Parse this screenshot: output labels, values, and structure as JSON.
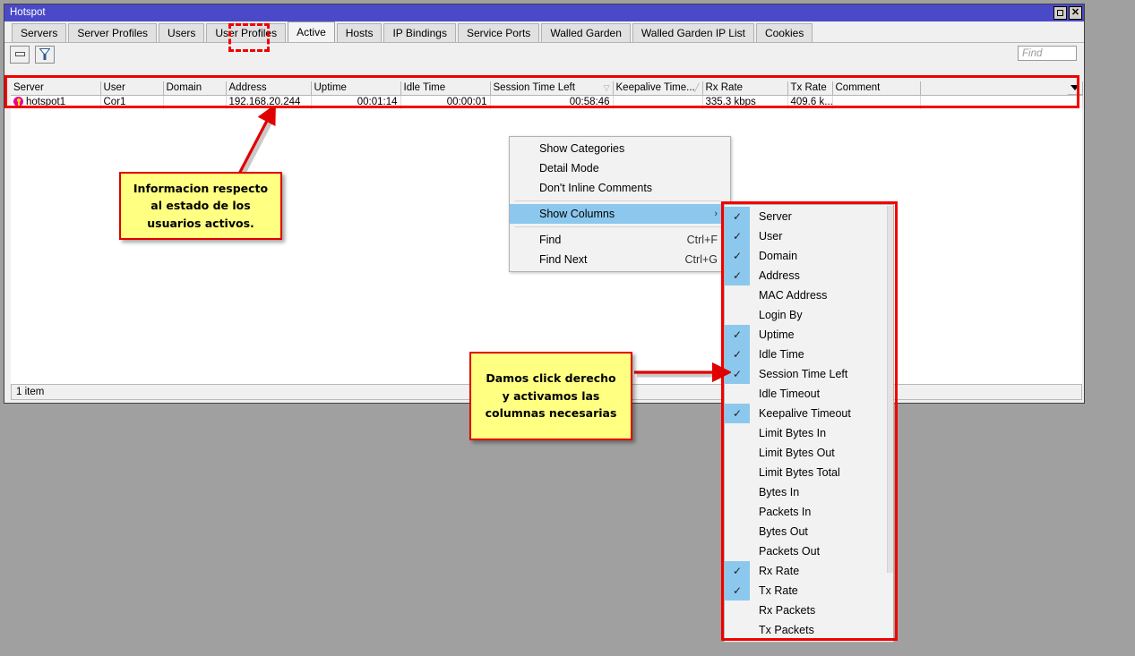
{
  "window": {
    "title": "Hotspot",
    "maximize_icon": "maximize-icon",
    "close_icon": "close-icon"
  },
  "tabs": [
    {
      "label": "Servers",
      "active": false
    },
    {
      "label": "Server Profiles",
      "active": false
    },
    {
      "label": "Users",
      "active": false
    },
    {
      "label": "User Profiles",
      "active": false
    },
    {
      "label": "Active",
      "active": true
    },
    {
      "label": "Hosts",
      "active": false
    },
    {
      "label": "IP Bindings",
      "active": false
    },
    {
      "label": "Service Ports",
      "active": false
    },
    {
      "label": "Walled Garden",
      "active": false
    },
    {
      "label": "Walled Garden IP List",
      "active": false
    },
    {
      "label": "Cookies",
      "active": false
    }
  ],
  "toolbar": {
    "remove_icon": "minus-icon",
    "filter_icon": "funnel-icon",
    "find_placeholder": "Find",
    "find_value": ""
  },
  "table": {
    "columns": [
      {
        "label": "Server",
        "sort": ""
      },
      {
        "label": "User",
        "sort": ""
      },
      {
        "label": "Domain",
        "sort": ""
      },
      {
        "label": "Address",
        "sort": ""
      },
      {
        "label": "Uptime",
        "sort": ""
      },
      {
        "label": "Idle Time",
        "sort": ""
      },
      {
        "label": "Session Time Left",
        "sort": "▽"
      },
      {
        "label": "Keepalive Time...",
        "sort": "╱"
      },
      {
        "label": "Rx Rate",
        "sort": ""
      },
      {
        "label": "Tx Rate",
        "sort": ""
      },
      {
        "label": "Comment",
        "sort": ""
      },
      {
        "label": "",
        "sort": ""
      }
    ],
    "rows": [
      {
        "icon": "hotspot-server-icon",
        "server": "hotspot1",
        "user": "Cor1",
        "domain": "",
        "address": "192.168.20.244",
        "uptime": "00:01:14",
        "idle_time": "00:00:01",
        "session_time_left": "00:58:46",
        "keepalive_timeout": "",
        "rx_rate": "335.3 kbps",
        "tx_rate": "409.6 k...",
        "comment": ""
      }
    ],
    "column_menu_icon": "chevron-down-icon"
  },
  "status": {
    "item_count": "1 item"
  },
  "context_menu": {
    "items": [
      {
        "label": "Show Categories",
        "accel": "",
        "selected": false,
        "submenu": false,
        "separator_after": false
      },
      {
        "label": "Detail Mode",
        "accel": "",
        "selected": false,
        "submenu": false,
        "separator_after": false
      },
      {
        "label": "Don't Inline Comments",
        "accel": "",
        "selected": false,
        "submenu": false,
        "separator_after": true
      },
      {
        "label": "Show Columns",
        "accel": "",
        "selected": true,
        "submenu": true,
        "separator_after": true
      },
      {
        "label": "Find",
        "accel": "Ctrl+F",
        "selected": false,
        "submenu": false,
        "separator_after": false
      },
      {
        "label": "Find Next",
        "accel": "Ctrl+G",
        "selected": false,
        "submenu": false,
        "separator_after": false
      }
    ],
    "submenu_arrow": "chevron-right-icon"
  },
  "show_columns_submenu": {
    "items": [
      {
        "label": "Server",
        "checked": true
      },
      {
        "label": "User",
        "checked": true
      },
      {
        "label": "Domain",
        "checked": true
      },
      {
        "label": "Address",
        "checked": true
      },
      {
        "label": "MAC Address",
        "checked": false
      },
      {
        "label": "Login By",
        "checked": false
      },
      {
        "label": "Uptime",
        "checked": true
      },
      {
        "label": "Idle Time",
        "checked": true
      },
      {
        "label": "Session Time Left",
        "checked": true
      },
      {
        "label": "Idle Timeout",
        "checked": false
      },
      {
        "label": "Keepalive Timeout",
        "checked": true
      },
      {
        "label": "Limit Bytes In",
        "checked": false
      },
      {
        "label": "Limit Bytes Out",
        "checked": false
      },
      {
        "label": "Limit Bytes Total",
        "checked": false
      },
      {
        "label": "Bytes In",
        "checked": false
      },
      {
        "label": "Packets In",
        "checked": false
      },
      {
        "label": "Bytes Out",
        "checked": false
      },
      {
        "label": "Packets Out",
        "checked": false
      },
      {
        "label": "Rx Rate",
        "checked": true
      },
      {
        "label": "Tx Rate",
        "checked": true
      },
      {
        "label": "Rx Packets",
        "checked": false
      },
      {
        "label": "Tx Packets",
        "checked": false
      }
    ],
    "check_glyph": "✓"
  },
  "annotations": {
    "note1": "Informacion respecto\nal estado de los\nusuarios activos.",
    "note2": "Damos click derecho\ny activamos las\ncolumnas necesarias"
  },
  "colors": {
    "titlebar": "#4a4ac8",
    "highlight_red": "#f20000",
    "note_yellow": "#ffff82",
    "menu_selection": "#8cc8ee",
    "desktop_gray": "#a0a0a0"
  }
}
